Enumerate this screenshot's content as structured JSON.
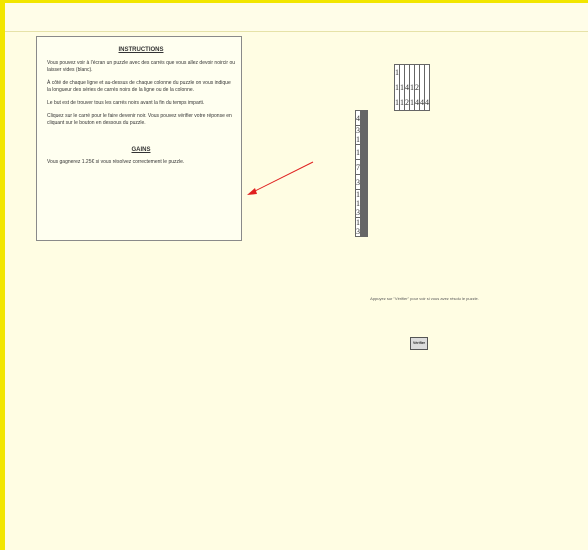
{
  "instructions": {
    "title": "INSTRUCTIONS",
    "p1": "Vous pouvez voir à l'écran un puzzle avec des carrés que vous allez devoir noircir ou laisser vides (blanc).",
    "p2": "À côté de chaque ligne et au-dessus de chaque colonne du puzzle on vous indique la longueur des séries de carrés noirs de la ligne ou de la colonne.",
    "p3": "Le but est de trouver tous les carrés noirs avant la fin du temps imparti.",
    "p4": "Cliquez sur le carré pour le faire devenir noir. Vous pouvez vérifier votre réponse en cliquant sur le bouton en dessous du puzzle.",
    "gains_title": "GAINS",
    "gains_text": "Vous gagnerez 1.25€ si vous résolvez correctement le puzzle."
  },
  "puzzle": {
    "column_clues": [
      [
        "1",
        "1",
        "1"
      ],
      [
        "1",
        "1"
      ],
      [
        "4",
        "2"
      ],
      [
        "1",
        "1"
      ],
      [
        "2",
        "4"
      ],
      [
        "4"
      ],
      [
        "4"
      ]
    ],
    "row_clues": [
      "4",
      "3 1",
      "1",
      "7",
      "3",
      "1 1 3",
      "1 3"
    ]
  },
  "hint_text": "Appuyez sur \"Vérifier\" pour voir si vous avez résolu le puzzle.",
  "verify_button": "Vérifier",
  "colors": {
    "frame_border": "#f2e600",
    "background": "#fffde3",
    "arrow": "#e02020"
  }
}
